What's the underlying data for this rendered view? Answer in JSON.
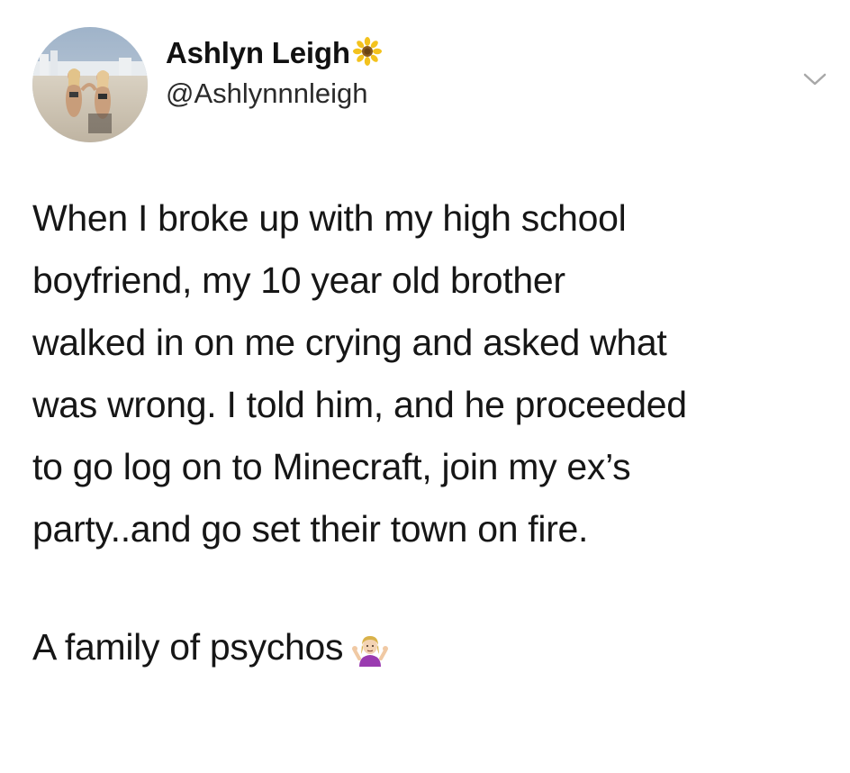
{
  "tweet": {
    "author": {
      "display_name": "Ashlyn Leigh",
      "handle": "@Ashlynnnleigh",
      "name_emoji": "sunflower-icon",
      "avatar": "beach-photo-avatar"
    },
    "menu_icon": "chevron-down-icon",
    "body_lines": [
      "When I broke up with my high school",
      "boyfriend, my 10 year old brother",
      "walked in on me crying and asked what",
      "was wrong. I told him, and he proceeded",
      "to go log on to Minecraft, join my ex’s",
      "party..and go set their town on fire."
    ],
    "closing_line": "A family of psychos",
    "closing_emoji": "person-shrugging-icon"
  },
  "colors": {
    "background": "#ffffff",
    "text": "#161616",
    "secondary_text": "#2a2a2a",
    "chevron": "#a8a8a8"
  }
}
